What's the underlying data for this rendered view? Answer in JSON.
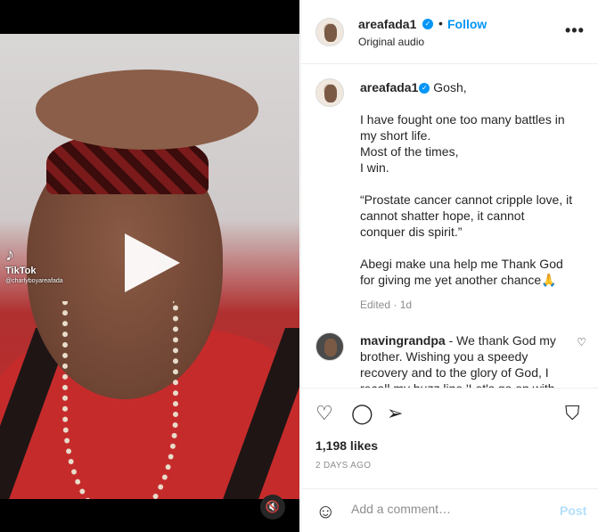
{
  "post": {
    "username": "areafada1",
    "follow_label": "Follow",
    "separator": "•",
    "subtitle": "Original audio",
    "more_label": "•••"
  },
  "media": {
    "watermark_brand": "TikTok",
    "watermark_handle": "@charlyboyareafada",
    "mute_icon": "🔇"
  },
  "caption": {
    "username": "areafada1",
    "greeting": "Gosh,",
    "paragraph1": [
      "I have fought one too many battles in",
      "my short life.",
      "Most of the times,",
      "I win."
    ],
    "paragraph2": [
      "“Prostate cancer cannot cripple love, it",
      "cannot shatter hope, it cannot",
      "conquer dis spirit.”"
    ],
    "paragraph3": [
      "Abegi make una help me Thank God",
      "for giving me yet another chance🙏"
    ],
    "meta": "Edited · 1d"
  },
  "comment1": {
    "username": "mavingrandpa",
    "text": " - We thank God my brother. Wishing you a speedy recovery and to the glory of God, I recall my buzz line 'Let's go on with"
  },
  "actions": {
    "likes": "1,198 likes",
    "date": "2 DAYS AGO"
  },
  "add_comment": {
    "placeholder": "Add a comment…",
    "post_label": "Post"
  },
  "colors": {
    "accent": "#0095f6",
    "post_disabled": "#b2dffc",
    "muted": "#8e8e8e"
  },
  "icons": {
    "verified": "verified-badge-icon",
    "heart": "heart-icon",
    "comment": "comment-icon",
    "share": "share-icon",
    "save": "bookmark-icon",
    "emoji": "emoji-icon",
    "play": "play-icon",
    "mute": "mute-icon"
  }
}
